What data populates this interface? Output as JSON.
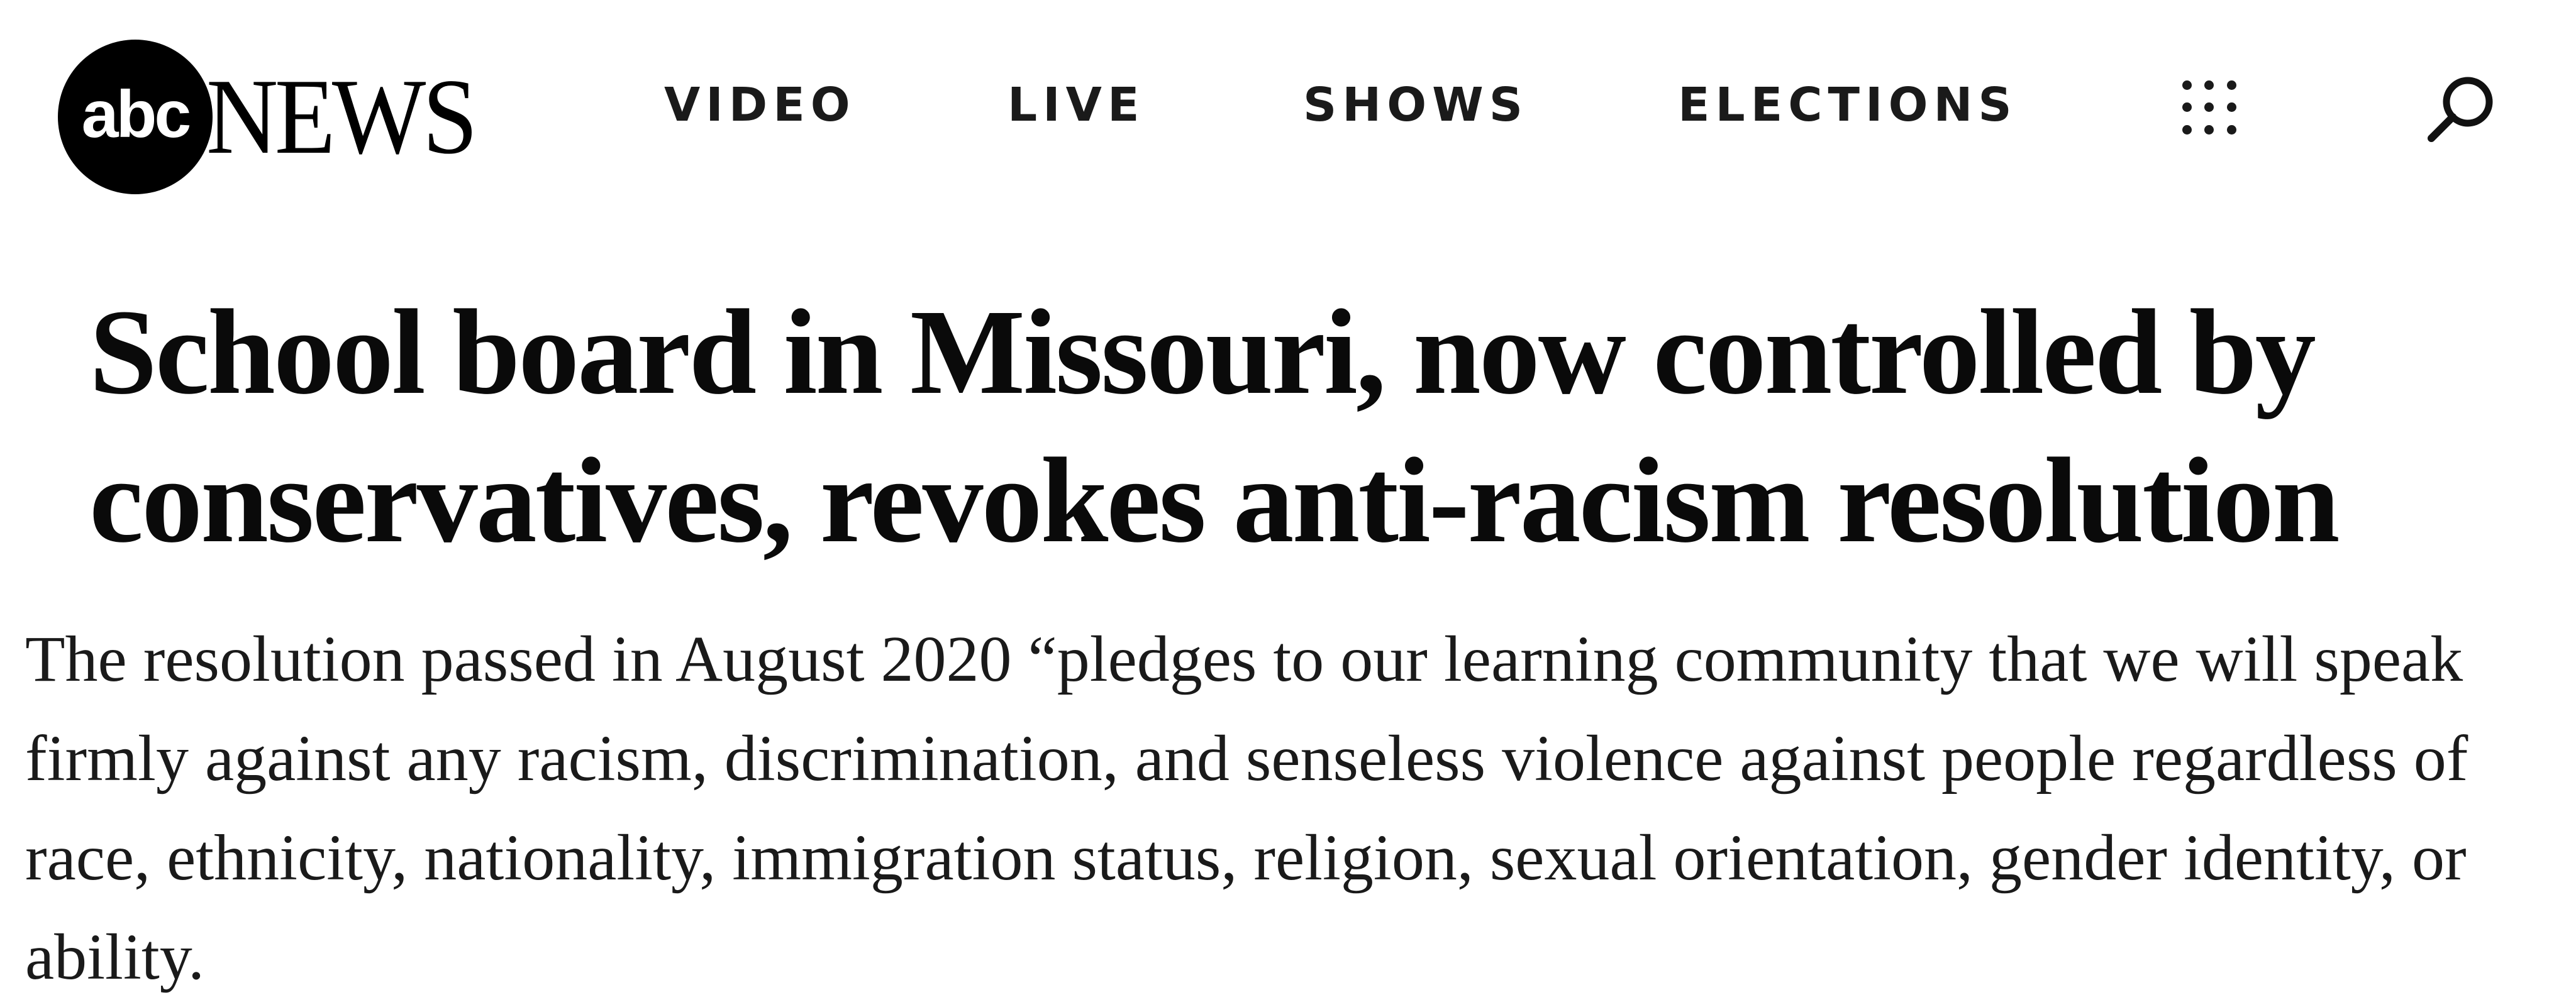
{
  "header": {
    "logo": {
      "abc": "abc",
      "news": "NEWS"
    },
    "nav": {
      "video": "VIDEO",
      "live": "LIVE",
      "shows": "SHOWS",
      "elections": "ELECTIONS"
    },
    "icons": {
      "menu": "grid-dots-icon",
      "search": "search-icon"
    }
  },
  "article": {
    "headline": "School board in Missouri, now controlled by conservatives, revokes anti-racism resolution",
    "dek": "The resolution passed in August 2020 “pledges to our learning community that we will speak firmly against any racism, discrimination, and senseless violence against people regardless of race, ethnicity, nationality, immigration status, religion, sexual orientation, gender identity, or ability."
  },
  "colors": {
    "background": "#ffffff",
    "text": "#000000",
    "logo_circle": "#000000"
  }
}
